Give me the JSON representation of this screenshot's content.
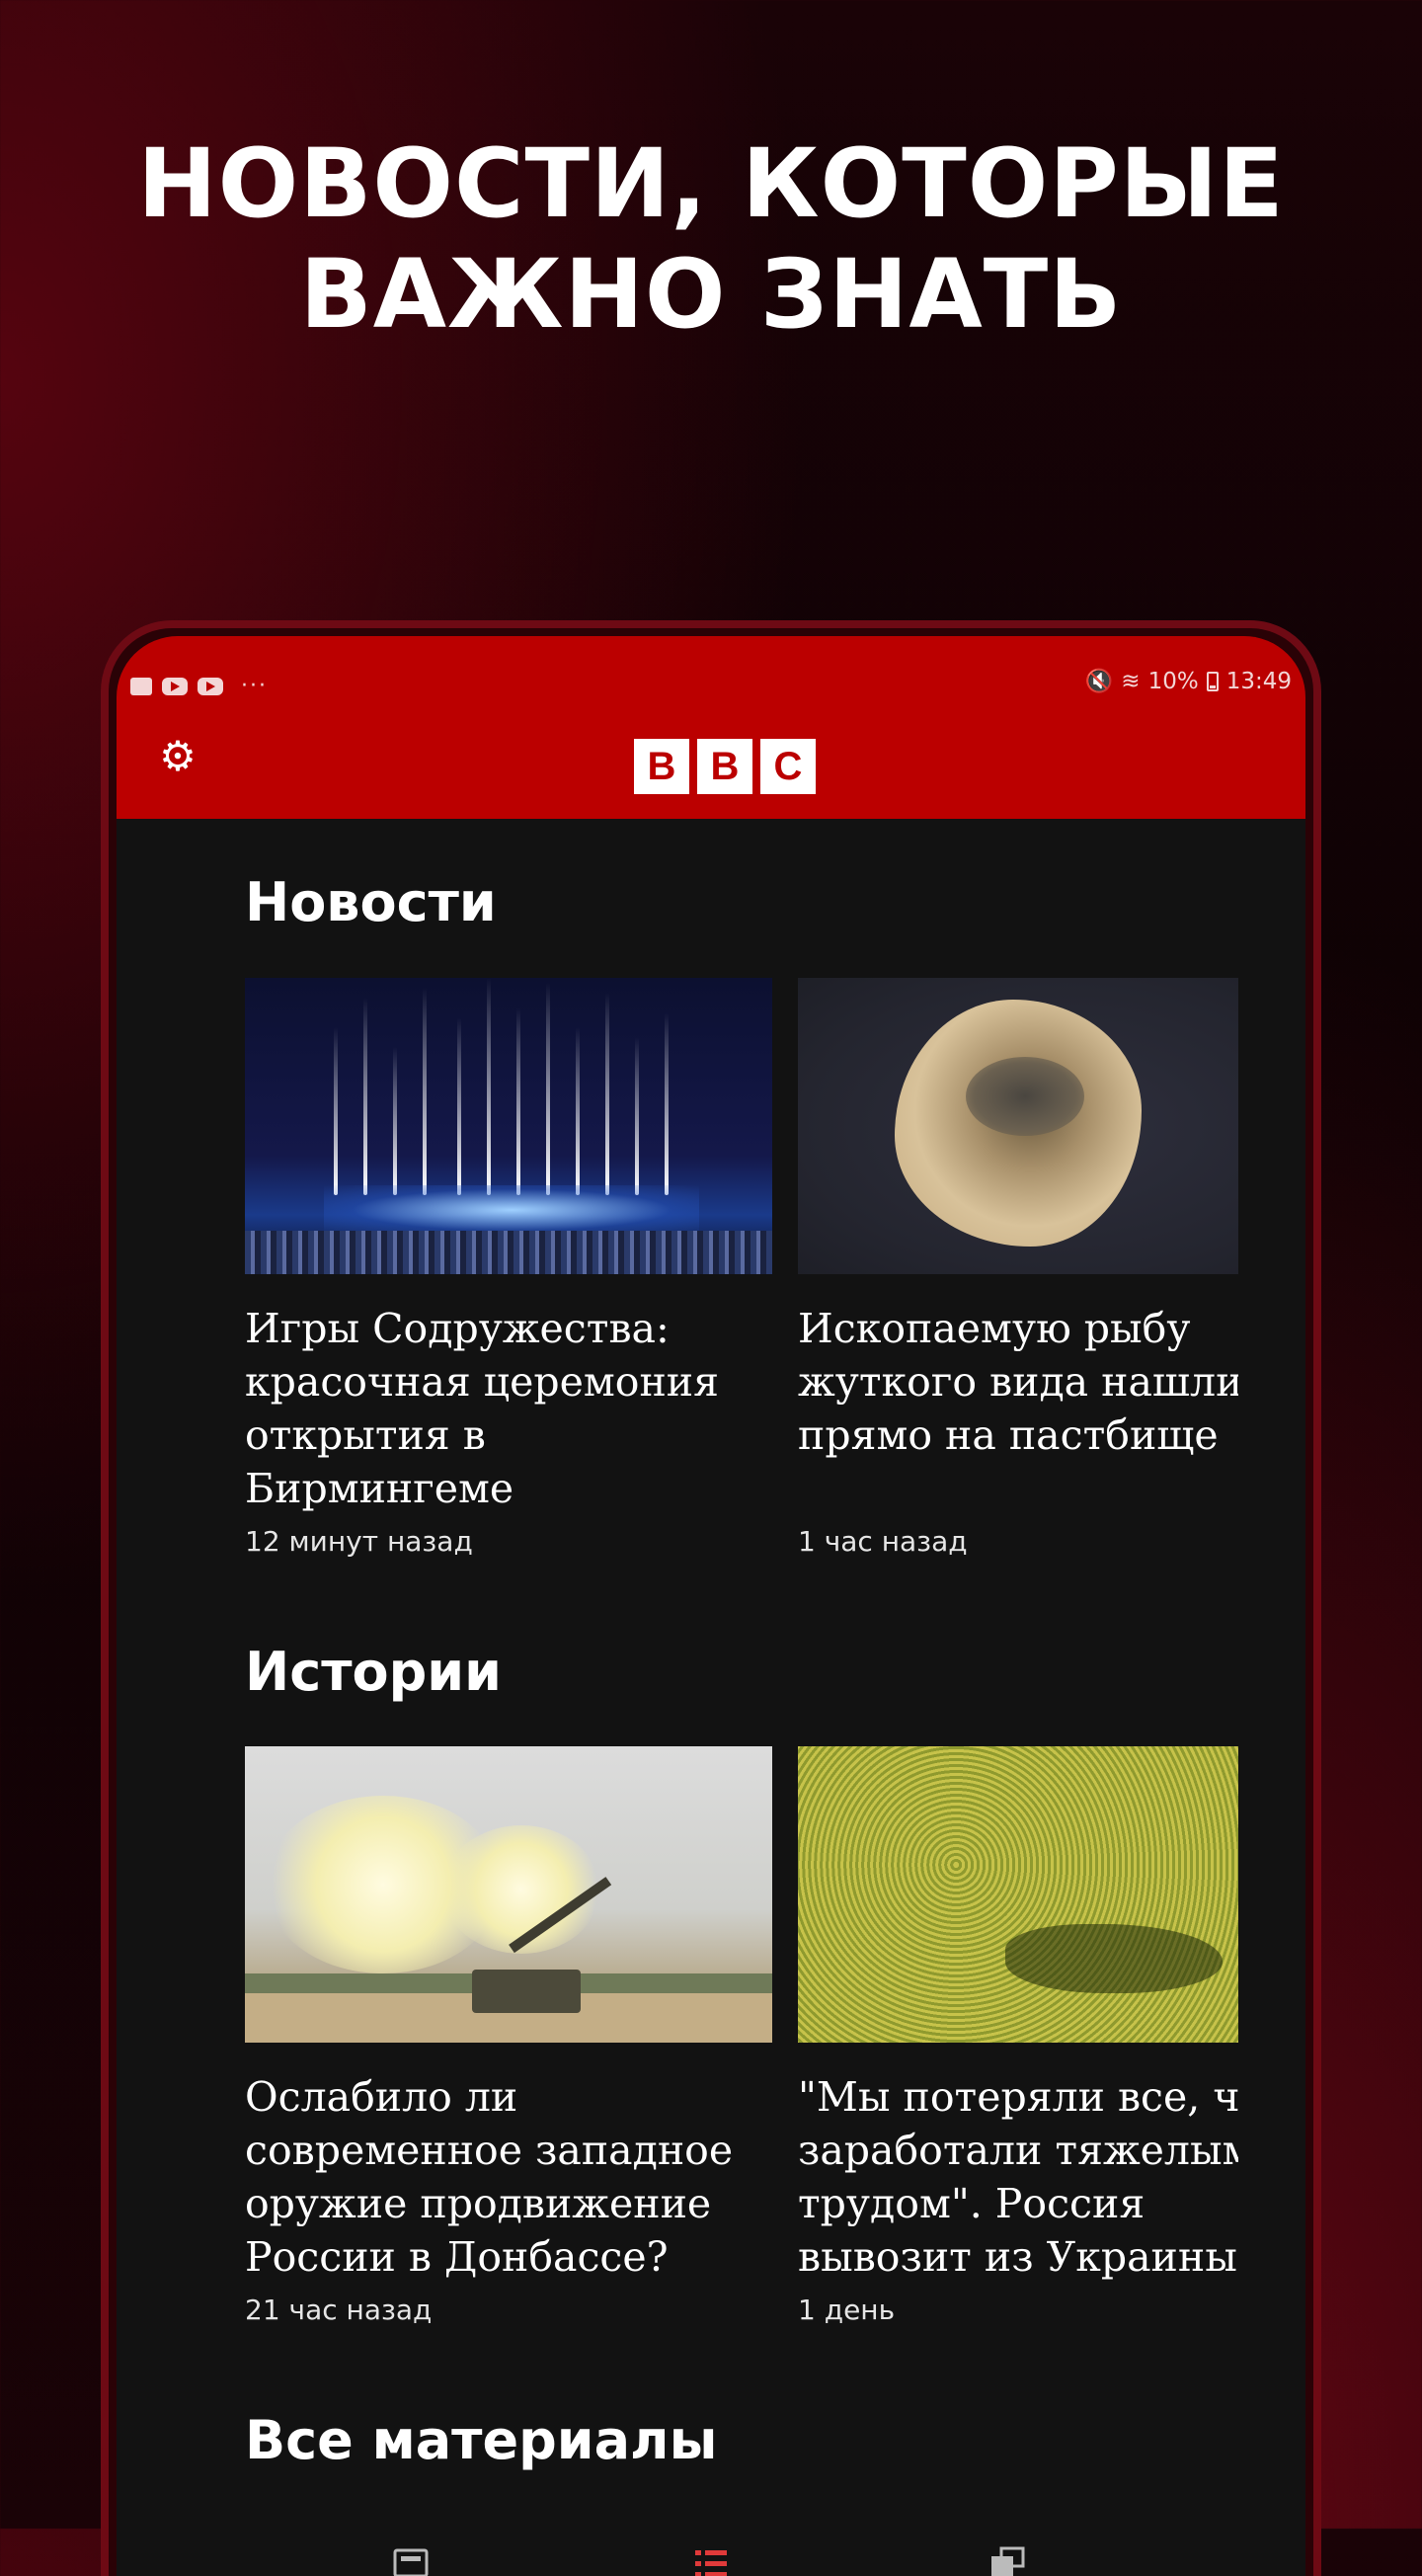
{
  "promo": {
    "headline_line1": "НОВОСТИ, КОТОРЫЕ",
    "headline_line2": "ВАЖНО ЗНАТЬ"
  },
  "status_bar": {
    "battery": "10%",
    "time": "13:49",
    "more": "···"
  },
  "app_bar": {
    "logo_letters": [
      "B",
      "B",
      "C"
    ],
    "brand_color": "#bb0000"
  },
  "sections": [
    {
      "title": "Новости",
      "cards": [
        {
          "title_lines": [
            "Игры Содружества:",
            "красочная церемония",
            "открытия в",
            "Бирмингеме"
          ],
          "time": "12 минут назад"
        },
        {
          "title_lines": [
            "Ископаемую рыбу",
            "жуткого вида нашли",
            "прямо на пастбище"
          ],
          "time": "1 час назад"
        }
      ]
    },
    {
      "title": "Истории",
      "cards": [
        {
          "title_lines": [
            "Ослабило ли",
            "современное западное",
            "оружие продвижение",
            "России в Донбассе?"
          ],
          "time": "21 час назад"
        },
        {
          "title_lines": [
            "\"Мы потеряли все, чт",
            "заработали тяжелым",
            "трудом\". Россия",
            "вывозит из Украины"
          ],
          "time": "1 день"
        }
      ]
    },
    {
      "title": "Все материалы"
    }
  ],
  "icons": {
    "settings": "gear-icon",
    "nav": [
      "home-icon",
      "list-icon",
      "stack-icon"
    ]
  }
}
